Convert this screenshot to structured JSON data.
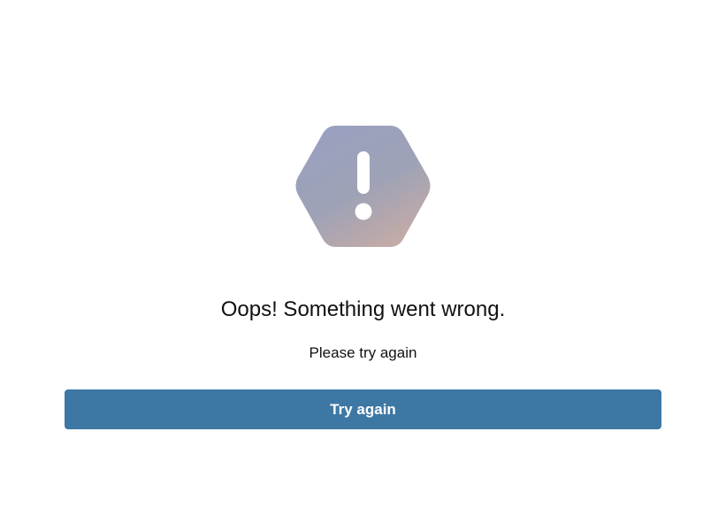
{
  "error": {
    "icon": "exclamation-hexagon-icon",
    "title": "Oops! Something went wrong.",
    "message": "Please try again",
    "retry_label": "Try again"
  },
  "colors": {
    "button_background": "#3d77a4",
    "button_text": "#ffffff",
    "icon_gradient_start": "#9aa0c0",
    "icon_gradient_end": "#c8aaa4",
    "text": "#111111",
    "page_background": "#ffffff"
  }
}
